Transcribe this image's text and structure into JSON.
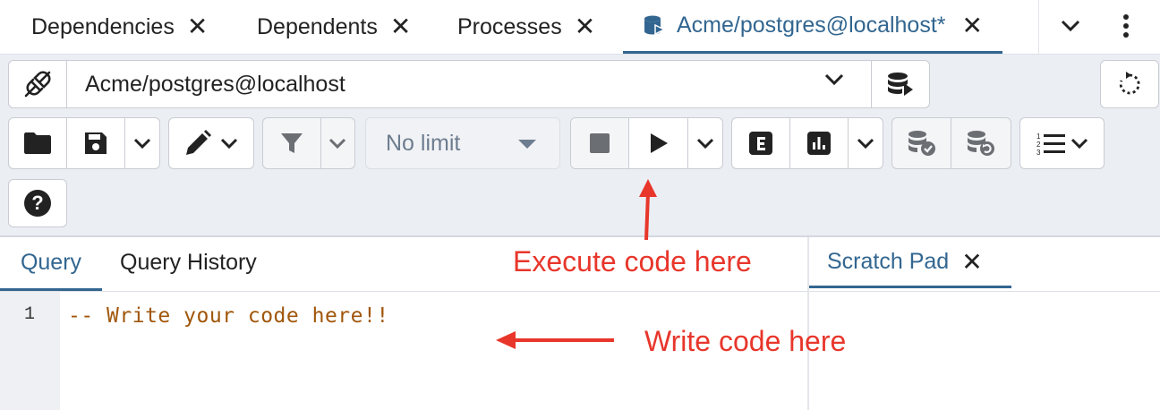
{
  "tabs": [
    {
      "label": "Dependencies"
    },
    {
      "label": "Dependents"
    },
    {
      "label": "Processes"
    },
    {
      "label": "Acme/postgres@localhost*",
      "active": true
    }
  ],
  "connection": {
    "value": "Acme/postgres@localhost"
  },
  "toolbar": {
    "limit_value": "No limit"
  },
  "editor_tabs": [
    {
      "label": "Query",
      "active": true
    },
    {
      "label": "Query History"
    }
  ],
  "scratch": {
    "label": "Scratch Pad"
  },
  "editor": {
    "line_number": "1",
    "code": "-- Write your code here!!"
  },
  "annotations": {
    "execute": "Execute code here",
    "write": "Write code here"
  },
  "colors": {
    "accent": "#326690",
    "annotation": "#e8362b",
    "comment": "#a0560a"
  }
}
